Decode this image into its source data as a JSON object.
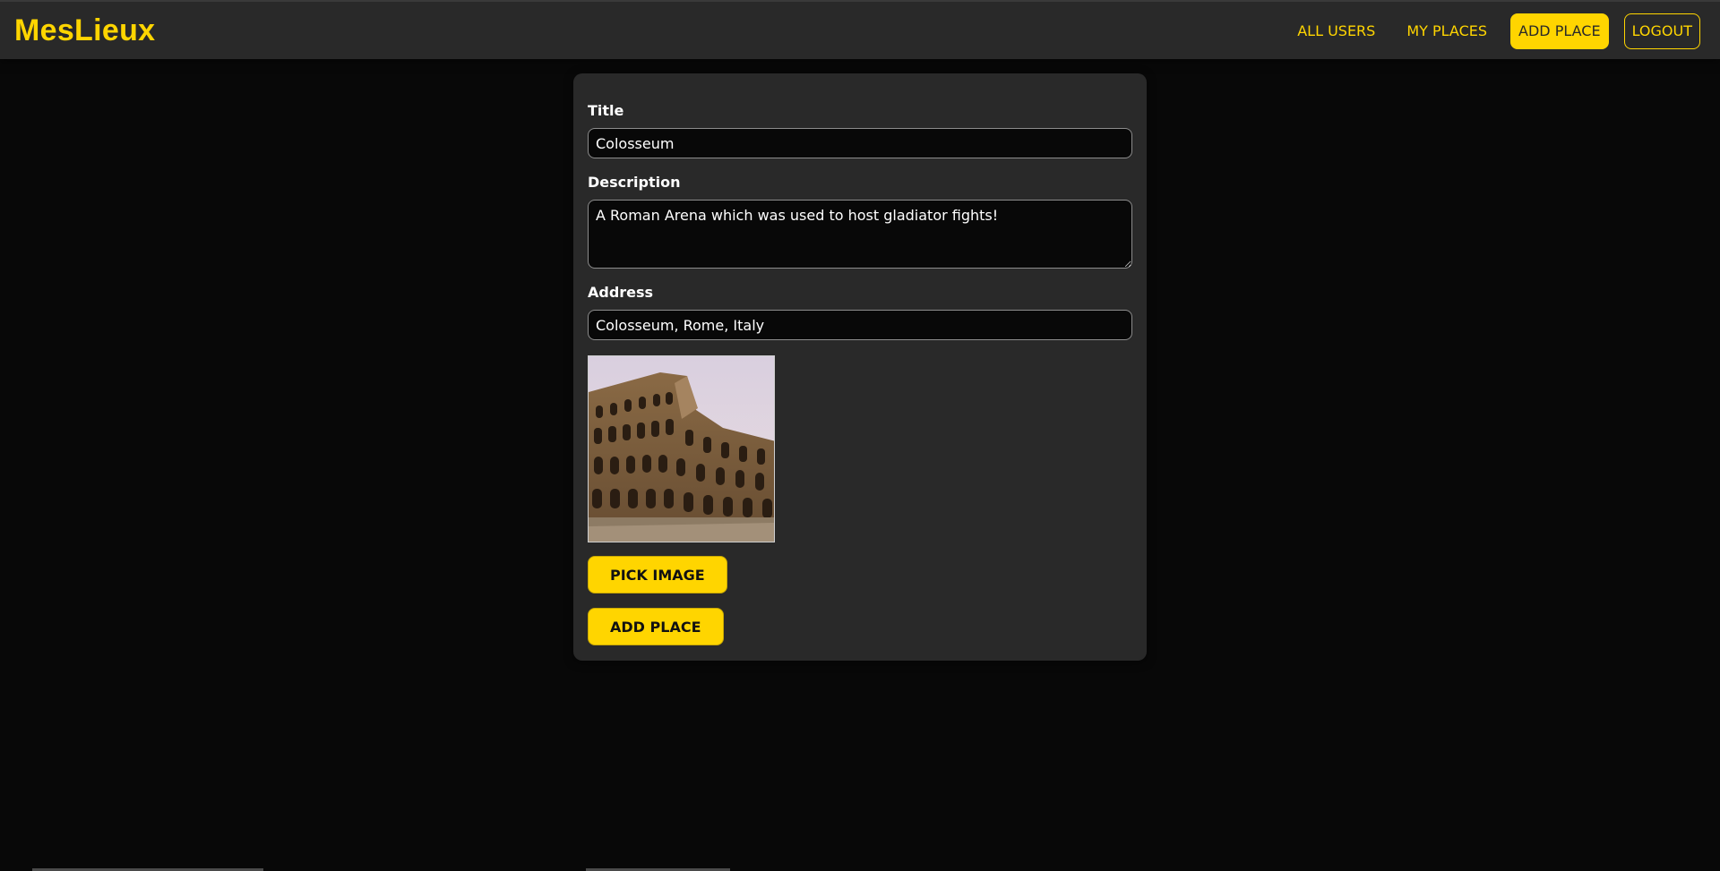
{
  "app": {
    "logo": "MesLieux"
  },
  "nav": {
    "all_users": "ALL USERS",
    "my_places": "MY PLACES",
    "add_place": "ADD PLACE",
    "logout": "LOGOUT"
  },
  "form": {
    "title_label": "Title",
    "title_value": "Colosseum",
    "description_label": "Description",
    "description_value": "A Roman Arena which was used to host gladiator fights!",
    "address_label": "Address",
    "address_value": "Colosseum, Rome, Italy",
    "pick_image": "PICK IMAGE",
    "submit": "ADD PLACE"
  },
  "colors": {
    "accent": "#ffd500",
    "background": "#080808",
    "surface": "#292929"
  }
}
